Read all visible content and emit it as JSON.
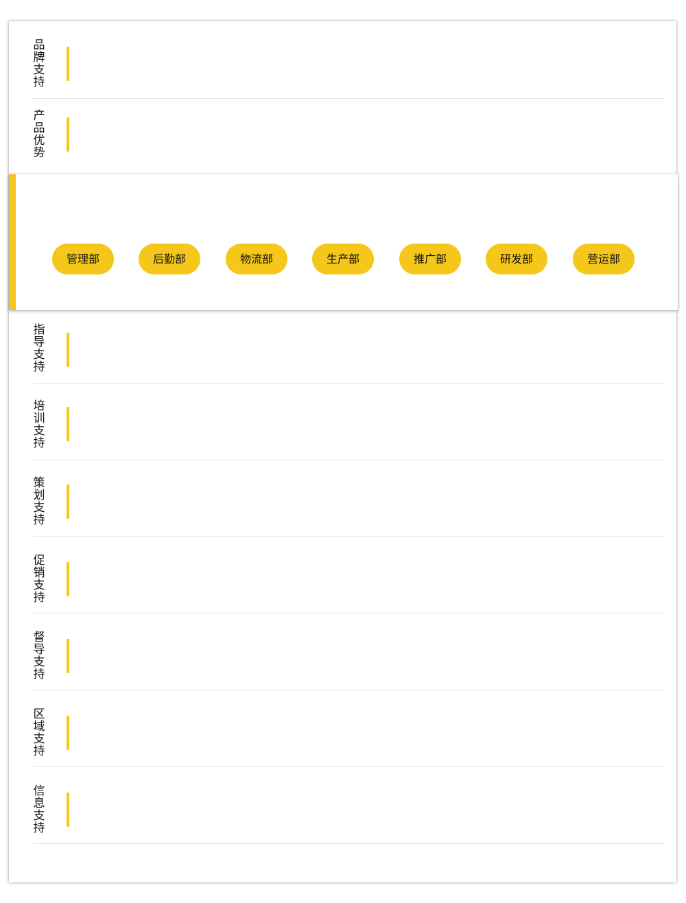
{
  "accent_color": "#f5c71a",
  "sections": [
    {
      "label": "品\n牌\n支\n持"
    },
    {
      "label": "产\n品\n优\n势"
    },
    {
      "label": "指\n导\n支\n持"
    },
    {
      "label": "培\n训\n支\n持"
    },
    {
      "label": "策\n划\n支\n持"
    },
    {
      "label": "促\n销\n支\n持"
    },
    {
      "label": "督\n导\n支\n持"
    },
    {
      "label": "区\n域\n支\n持"
    },
    {
      "label": "信\n息\n支\n持"
    }
  ],
  "departments": [
    "管理部",
    "后勤部",
    "物流部",
    "生产部",
    "推广部",
    "研发部",
    "营运部"
  ]
}
